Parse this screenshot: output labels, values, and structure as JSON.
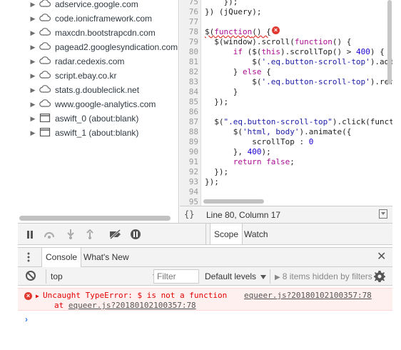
{
  "file_tree": [
    {
      "label": "adservice.google.com",
      "icon": "cloud-icon"
    },
    {
      "label": "code.ionicframework.com",
      "icon": "cloud-icon"
    },
    {
      "label": "maxcdn.bootstrapcdn.com",
      "icon": "cloud-icon"
    },
    {
      "label": "pagead2.googlesyndication.com",
      "icon": "cloud-icon"
    },
    {
      "label": "radar.cedexis.com",
      "icon": "cloud-icon"
    },
    {
      "label": "script.ebay.co.kr",
      "icon": "cloud-icon"
    },
    {
      "label": "stats.g.doubleclick.net",
      "icon": "cloud-icon"
    },
    {
      "label": "www.google-analytics.com",
      "icon": "cloud-icon"
    },
    {
      "label": "aswift_0 (about:blank)",
      "icon": "frame-icon"
    },
    {
      "label": "aswift_1 (about:blank)",
      "icon": "frame-icon"
    }
  ],
  "editor": {
    "lines": [
      {
        "n": "75",
        "code": "    });"
      },
      {
        "n": "76",
        "code": "}) (jQuery);"
      },
      {
        "n": "77",
        "code": ""
      },
      {
        "n": "78",
        "code": "$(function() {"
      },
      {
        "n": "79",
        "code": "  $(window).scroll(function() {"
      },
      {
        "n": "80",
        "code": "      if ($(this).scrollTop() > 400) {"
      },
      {
        "n": "81",
        "code": "          $('.eq.button-scroll-top').add"
      },
      {
        "n": "82",
        "code": "      } else {"
      },
      {
        "n": "83",
        "code": "          $('.eq.button-scroll-top').rem"
      },
      {
        "n": "84",
        "code": "      }"
      },
      {
        "n": "85",
        "code": "  });"
      },
      {
        "n": "86",
        "code": ""
      },
      {
        "n": "87",
        "code": "  $(\".eq.button-scroll-top\").click(funct"
      },
      {
        "n": "88",
        "code": "      $('html, body').animate({"
      },
      {
        "n": "89",
        "code": "          scrollTop : 0"
      },
      {
        "n": "90",
        "code": "      }, 400);"
      },
      {
        "n": "91",
        "code": "      return false;"
      },
      {
        "n": "92",
        "code": "  });"
      },
      {
        "n": "93",
        "code": "});"
      },
      {
        "n": "94",
        "code": ""
      },
      {
        "n": "95",
        "code": ""
      }
    ],
    "status": {
      "braces": "{}",
      "cursor": "Line 80, Column 17"
    }
  },
  "debugger": {
    "sidebar_tabs": [
      "Scope",
      "Watch"
    ]
  },
  "drawer": {
    "tabs": [
      "Console",
      "What's New"
    ]
  },
  "console": {
    "context": "top",
    "filter_placeholder": "Filter",
    "levels": "Default levels",
    "hidden": "8 items hidden by filters",
    "error": {
      "text": "Uncaught TypeError: $ is not a function",
      "source": "equeer.js?20180102100357:78",
      "at_prefix": "at ",
      "at_link": "equeer.js?20180102100357:78"
    },
    "prompt": "›"
  },
  "colors": {
    "error_bg": "#fff0f0",
    "error_text": "#e20000",
    "prompt": "#367cf1"
  }
}
